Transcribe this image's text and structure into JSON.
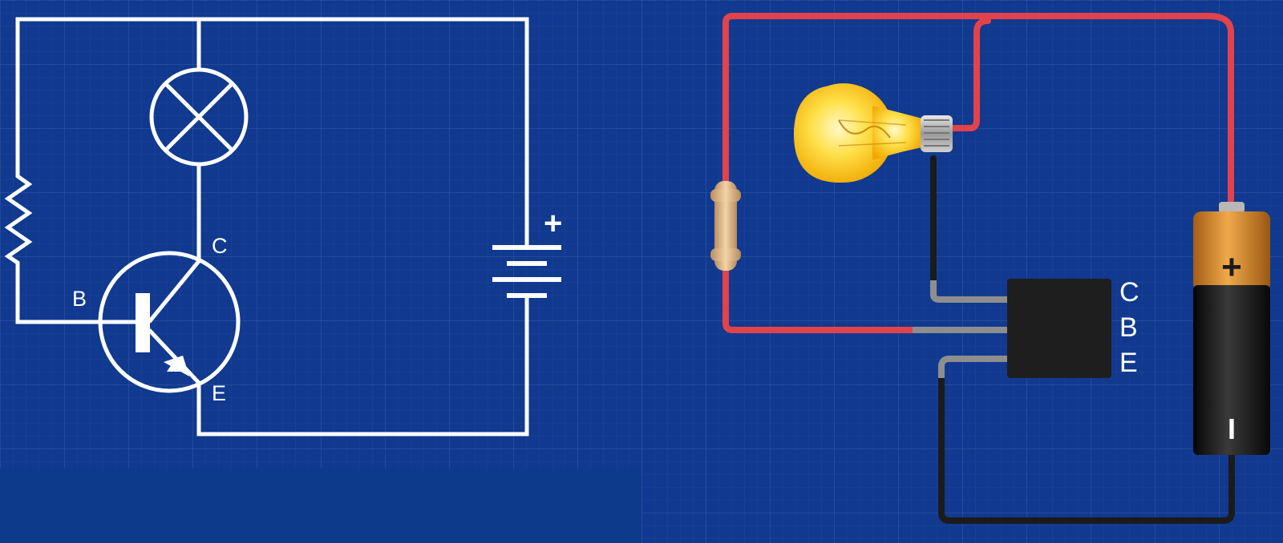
{
  "schematic": {
    "labels": {
      "base": "B",
      "collector": "C",
      "emitter": "E",
      "battery_plus": "+"
    }
  },
  "breadboard": {
    "transistor_pins": [
      "C",
      "B",
      "E"
    ],
    "battery": {
      "plus": "+",
      "minus": "I"
    }
  },
  "colors": {
    "background": "#10398f",
    "schematic_line": "#ffffff",
    "wire_positive": "#e2434a",
    "wire_negative": "#1b1b1b",
    "transistor_body": "#1e1e1e",
    "bulb_glass": "#ffd93a",
    "battery_top": "#d98a2c",
    "battery_body": "#1a1a1a"
  }
}
